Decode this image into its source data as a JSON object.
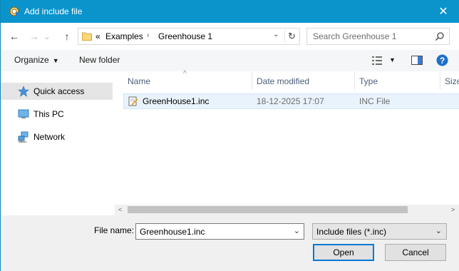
{
  "window": {
    "title": "Add include file",
    "close_glyph": "✕"
  },
  "nav": {
    "back_glyph": "←",
    "forward_glyph": "→",
    "recent_glyph": "⌄",
    "up_glyph": "↑",
    "address": {
      "overflow": "«",
      "crumbs": [
        "Examples",
        "Greenhouse 1"
      ],
      "sep": "›",
      "dropdown_glyph": "⌄",
      "refresh_glyph": "↻"
    },
    "search": {
      "placeholder": "Search Greenhouse 1"
    }
  },
  "toolbar": {
    "organize_label": "Organize",
    "caret": "▼",
    "new_folder_label": "New folder",
    "view_caret": "▼",
    "help_glyph": "?"
  },
  "sidebar": {
    "items": [
      {
        "label": "Quick access",
        "icon": "star-icon",
        "selected": true
      },
      {
        "label": "This PC",
        "icon": "monitor-icon",
        "selected": false
      },
      {
        "label": "Network",
        "icon": "network-icon",
        "selected": false
      }
    ]
  },
  "columns": {
    "name": "Name",
    "date": "Date modified",
    "type": "Type",
    "size": "Size",
    "sort_glyph": "^"
  },
  "files": [
    {
      "name": "GreenHouse1.inc",
      "date": "18-12-2025 17:07",
      "type": "INC File"
    }
  ],
  "scroll": {
    "left": "<",
    "right": ">"
  },
  "bottom": {
    "filename_label": "File name:",
    "filename_value": "Greenhouse1.inc",
    "filename_dd": "⌄",
    "filter_value": "Include files (*.inc)",
    "filter_dd": "⌄",
    "open_label": "Open",
    "cancel_label": "Cancel"
  },
  "colors": {
    "titlebar": "#0b94cc",
    "selection": "#e9f3fb",
    "accent": "#0078d7",
    "help": "#1e6fc9"
  }
}
